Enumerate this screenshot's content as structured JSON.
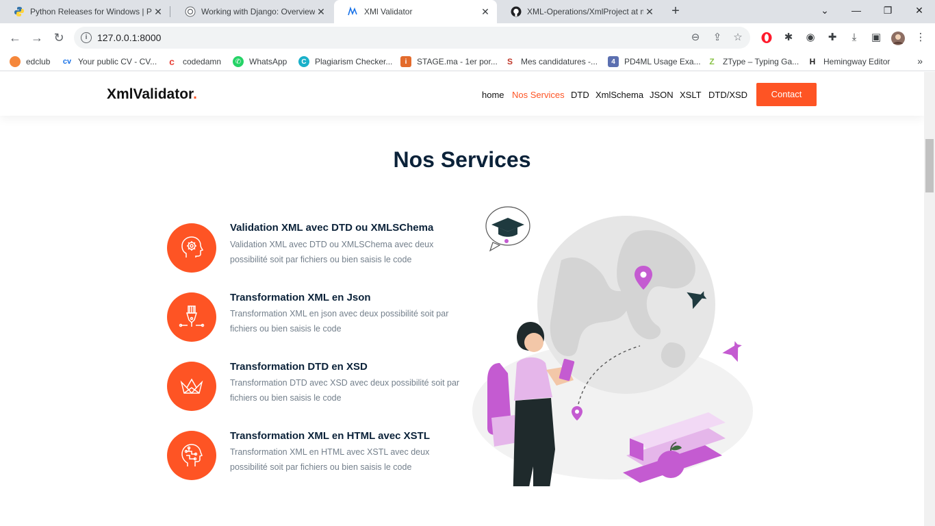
{
  "browser": {
    "tabs": [
      {
        "title": "Python Releases for Windows | Py",
        "icon": "python-icon",
        "active": false
      },
      {
        "title": "Working with Django: Overview",
        "icon": "chatgpt-icon",
        "active": false
      },
      {
        "title": "XMl Validator",
        "icon": "xml-validator-icon",
        "active": true
      },
      {
        "title": "XML-Operations/XmlProject at m",
        "icon": "github-icon",
        "active": false
      }
    ],
    "url": "127.0.0.1:8000",
    "bookmarks": [
      {
        "label": "edclub",
        "icon": "edclub-icon",
        "color": "#f5873b",
        "glyph": "●"
      },
      {
        "label": "Your public CV - CV...",
        "icon": "cv-icon",
        "color": "#1a73e8",
        "glyph": "cv"
      },
      {
        "label": "codedamn",
        "icon": "codedamn-icon",
        "color": "#e8453c",
        "glyph": "c"
      },
      {
        "label": "WhatsApp",
        "icon": "whatsapp-icon",
        "color": "#25d366",
        "glyph": "✆"
      },
      {
        "label": "Plagiarism Checker...",
        "icon": "plagiarism-icon",
        "color": "#1ab0c9",
        "glyph": "C"
      },
      {
        "label": "STAGE.ma - 1er por...",
        "icon": "stage-icon",
        "color": "#e36b2c",
        "glyph": "i"
      },
      {
        "label": "Mes candidatures -...",
        "icon": "candidatures-icon",
        "color": "#c0392b",
        "glyph": "S"
      },
      {
        "label": "PD4ML Usage Exa...",
        "icon": "pd4ml-icon",
        "color": "#5b6fb0",
        "glyph": "4"
      },
      {
        "label": "ZType – Typing Ga...",
        "icon": "ztype-icon",
        "color": "#8bc34a",
        "glyph": "Z"
      },
      {
        "label": "Hemingway Editor",
        "icon": "hemingway-icon",
        "color": "#222222",
        "glyph": "H"
      }
    ]
  },
  "site": {
    "logo": "XmlValidator",
    "logo_dot": ".",
    "nav": [
      "home",
      "Nos Services",
      "DTD",
      "XmlSchema",
      "JSON",
      "XSLT",
      "DTD/XSD"
    ],
    "active_nav": "Nos Services",
    "contact": "Contact",
    "accent_color": "#fe5424"
  },
  "services": {
    "title": "Nos Services",
    "items": [
      {
        "title": "Validation XML avec DTD ou XMLSChema",
        "description": "Validation XML avec DTD ou XMLSChema avec deux possibilité soit par fichiers ou bien saisis le code",
        "icon": "brain-gear-icon"
      },
      {
        "title": "Transformation XML en Json",
        "description": "Transformation XML en json avec deux possibilité soit par fichiers ou bien saisis le code",
        "icon": "pen-tool-icon"
      },
      {
        "title": "Transformation DTD en XSD",
        "description": "Transformation DTD avec XSD avec deux possibilité soit par fichiers ou bien saisis le code",
        "icon": "origami-crown-icon"
      },
      {
        "title": "Transformation XML en HTML avec XSTL",
        "description": "Transformation XML en HTML avec XSTL avec deux possibilité soit par fichiers ou bien saisis le code",
        "icon": "head-circuit-icon"
      }
    ]
  }
}
